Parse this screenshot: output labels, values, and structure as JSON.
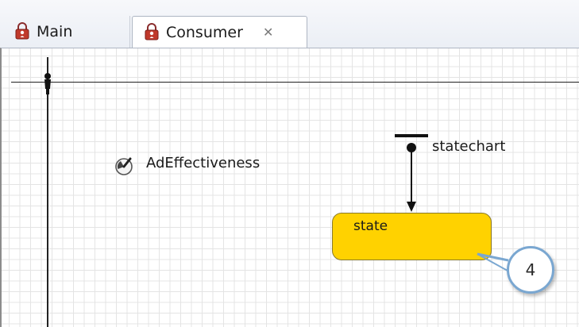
{
  "tabs": [
    {
      "label": "Main",
      "icon": "agent-lock-icon"
    },
    {
      "label": "Consumer",
      "icon": "agent-lock-icon",
      "close_glyph": "✕",
      "active": true
    }
  ],
  "canvas": {
    "parameter": {
      "label": "AdEffectiveness",
      "icon": "parameter-icon"
    },
    "statechart": {
      "label": "statechart",
      "icon": "statechart-entry-icon"
    },
    "state": {
      "label": "state",
      "fill": "#ffd200"
    }
  },
  "callout": {
    "number": "4",
    "border": "#7aa7d1"
  }
}
